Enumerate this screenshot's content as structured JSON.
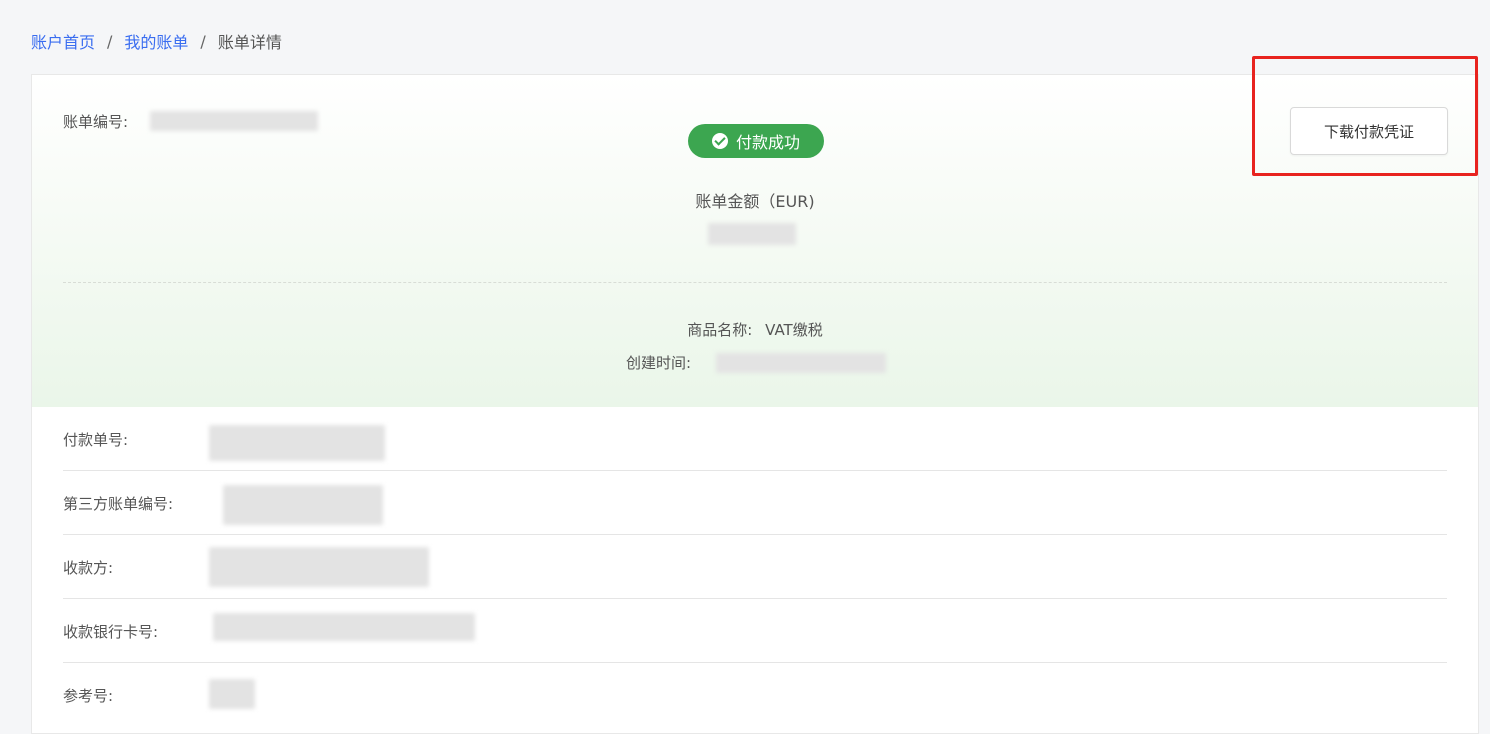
{
  "breadcrumb": {
    "home": "账户首页",
    "sep1": "/",
    "bills": "我的账单",
    "sep2": "/",
    "current": "账单详情"
  },
  "bill": {
    "number_label": "账单编号:",
    "status": "付款成功",
    "amount_label": "账单金额（EUR)",
    "product_label": "商品名称:",
    "product_value": "VAT缴税",
    "created_label": "创建时间:"
  },
  "actions": {
    "download_receipt": "下载付款凭证"
  },
  "details": [
    {
      "label": "付款单号:"
    },
    {
      "label": "第三方账单编号:"
    },
    {
      "label": "收款方:"
    },
    {
      "label": "收款银行卡号:"
    },
    {
      "label": "参考号:"
    }
  ],
  "colors": {
    "status_green": "#3ca650",
    "link_blue": "#3a6df0",
    "highlight_red": "#e8231f"
  },
  "icons": {
    "status": "check-circle-icon"
  }
}
